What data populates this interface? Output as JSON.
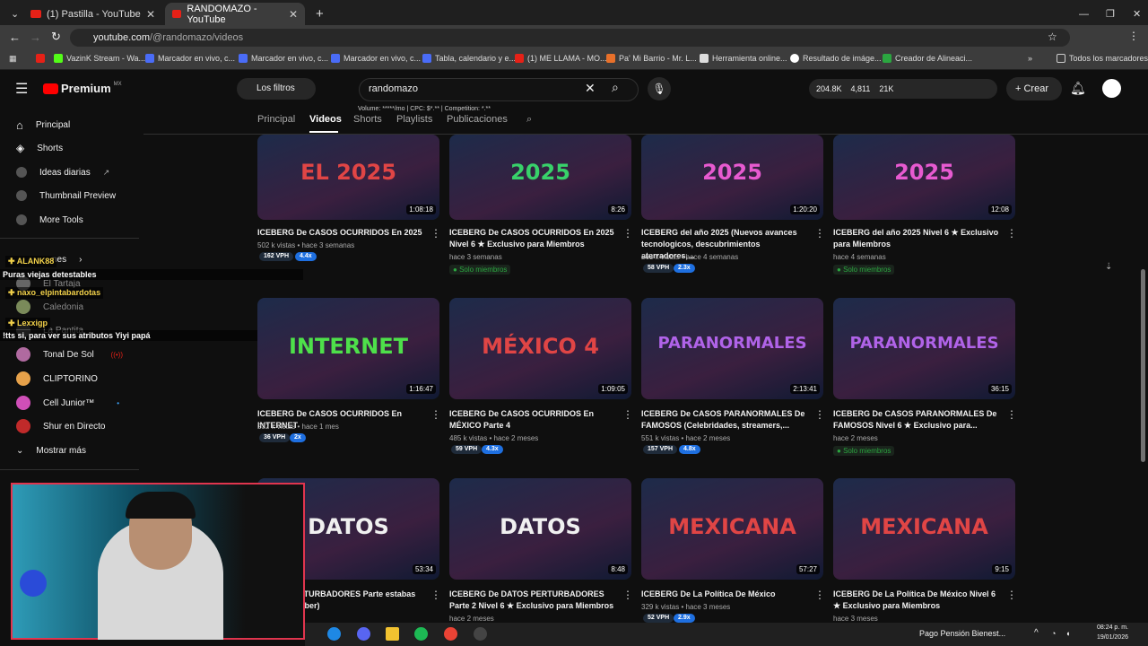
{
  "browser": {
    "tabs": [
      {
        "label": "(1) Pastilla - YouTube"
      },
      {
        "label": "RANDOMAZO - YouTube"
      }
    ],
    "url_host": "youtube.com",
    "url_path": "/@randomazo/videos",
    "bookmarks": [
      "VazinK Stream - Wa...",
      "Marcador en vivo, c...",
      "Marcador en vivo, c...",
      "Marcador en vivo, c...",
      "Tabla, calendario y e...",
      "(1) ME LLAMA - MO...",
      "Pa' Mi Barrio - Mr. L...",
      "Herramienta online...",
      "Resultado de imáge...",
      "Creador de Alineaci..."
    ],
    "all_bookmarks": "Todos los marcadores"
  },
  "header": {
    "logo": "Premium",
    "region": "MX",
    "filters_label": "Los filtros",
    "search_value": "randomazo",
    "keyword_line": "Volume: *****/mo | CPC: $*.** | Competition: *.**",
    "stats": [
      "204.8K",
      "4,811",
      "21K"
    ],
    "create_label": "Crear"
  },
  "channel_tabs": [
    "Principal",
    "Videos",
    "Shorts",
    "Playlists",
    "Publicaciones"
  ],
  "sidebar": {
    "items": [
      {
        "label": "Principal"
      },
      {
        "label": "Shorts"
      },
      {
        "label": "Ideas diarias"
      },
      {
        "label": "Thumbnail Preview"
      },
      {
        "label": "More Tools"
      }
    ],
    "section_partial": "nes",
    "subs": [
      {
        "label": "El Tartaja"
      },
      {
        "label": "Caledonia"
      },
      {
        "label": "La Pantita"
      },
      {
        "label": "Tonal De Sol"
      },
      {
        "label": "CLIPTORINO"
      },
      {
        "label": "Cell Junior™"
      },
      {
        "label": "Shur en Directo"
      }
    ],
    "more_label": "Mostrar más"
  },
  "chat": [
    {
      "user": "ALANK88",
      "msg": "Puras viejas detestables"
    },
    {
      "user": "naxo_elpintabardotas",
      "msg": ""
    },
    {
      "user": "Lexxigp",
      "msg": "!tts si, para ver sus atributos Yiyi papá"
    }
  ],
  "videos": [
    {
      "thumb_text": "EL 2025",
      "thumb_color": "#e04545",
      "duration": "1:08:18",
      "title": "ICEBERG De CASOS OCURRIDOS En 2025",
      "meta": "502 k vistas • hace 3 semanas",
      "vph": "162 VPH",
      "mult": "4.4x",
      "members": ""
    },
    {
      "thumb_text": "2025",
      "thumb_color": "#38d16a",
      "duration": "8:26",
      "title": "ICEBERG De CASOS OCURRIDOS En 2025 Nivel 6 ★ Exclusivo para Miembros",
      "meta": "hace 3 semanas",
      "vph": "",
      "mult": "",
      "members": "Solo miembros"
    },
    {
      "thumb_text": "2025",
      "thumb_color": "#e75ad0",
      "duration": "1:20:20",
      "title": "ICEBERG del año 2025 (Nuevos avances tecnologicos, descubrimientos aterradores,...",
      "meta": "263 k vistas • hace 4 semanas",
      "vph": "58 VPH",
      "mult": "2.3x",
      "members": ""
    },
    {
      "thumb_text": "2025",
      "thumb_color": "#e75ad0",
      "duration": "12:08",
      "title": "ICEBERG del año 2025 Nivel 6 ★ Exclusivo para Miembros",
      "meta": "hace 4 semanas",
      "vph": "",
      "mult": "",
      "members": "Solo miembros"
    },
    {
      "thumb_text": "INTERNET",
      "thumb_color": "#4ee04a",
      "duration": "1:16:47",
      "title": "ICEBERG De CASOS OCURRIDOS En INTERNET",
      "meta": "232 k vistas • hace 1 mes",
      "vph": "36 VPH",
      "mult": "2x",
      "members": ""
    },
    {
      "thumb_text": "MÉXICO 4",
      "thumb_color": "#e04545",
      "duration": "1:09:05",
      "title": "ICEBERG De CASOS OCURRIDOS En MÉXICO Parte 4",
      "meta": "485 k vistas • hace 2 meses",
      "vph": "59 VPH",
      "mult": "4.3x",
      "members": ""
    },
    {
      "thumb_text": "PARANORMALES",
      "thumb_color": "#b063e8",
      "duration": "2:13:41",
      "title": "ICEBERG De CASOS PARANORMALES De FAMOSOS (Celebridades, streamers,...",
      "meta": "551 k vistas • hace 2 meses",
      "vph": "157 VPH",
      "mult": "4.8x",
      "members": ""
    },
    {
      "thumb_text": "PARANORMALES",
      "thumb_color": "#b063e8",
      "duration": "36:15",
      "title": "ICEBERG De CASOS PARANORMALES De FAMOSOS Nivel 6 ★ Exclusivo para...",
      "meta": "hace 2 meses",
      "vph": "",
      "mult": "",
      "members": "Solo miembros"
    },
    {
      "thumb_text": "DATOS",
      "thumb_color": "#f0f0f0",
      "duration": "53:34",
      "title": "DATOS PERTURBADORES Parte estabas mejor sin saber)",
      "meta": "hace 2 meses",
      "vph": "",
      "mult": "",
      "members": ""
    },
    {
      "thumb_text": "DATOS",
      "thumb_color": "#f0f0f0",
      "duration": "8:48",
      "title": "ICEBERG De DATOS PERTURBADORES Parte 2 Nivel 6 ★ Exclusivo para Miembros",
      "meta": "hace 2 meses",
      "vph": "",
      "mult": "",
      "members": ""
    },
    {
      "thumb_text": "MEXICANA",
      "thumb_color": "#e04545",
      "duration": "57:27",
      "title": "ICEBERG De La Política De México",
      "meta": "329 k vistas • hace 3 meses",
      "vph": "52 VPH",
      "mult": "2.9x",
      "members": ""
    },
    {
      "thumb_text": "MEXICANA",
      "thumb_color": "#e04545",
      "duration": "9:15",
      "title": "ICEBERG De La Política De México Nivel 6 ★ Exclusivo para Miembros",
      "meta": "hace 3 meses",
      "vph": "",
      "mult": "",
      "members": ""
    }
  ],
  "taskbar": {
    "notification": "Pago Pensión Bienest...",
    "time": "08:24 p. m.",
    "date": "19/01/2026"
  }
}
